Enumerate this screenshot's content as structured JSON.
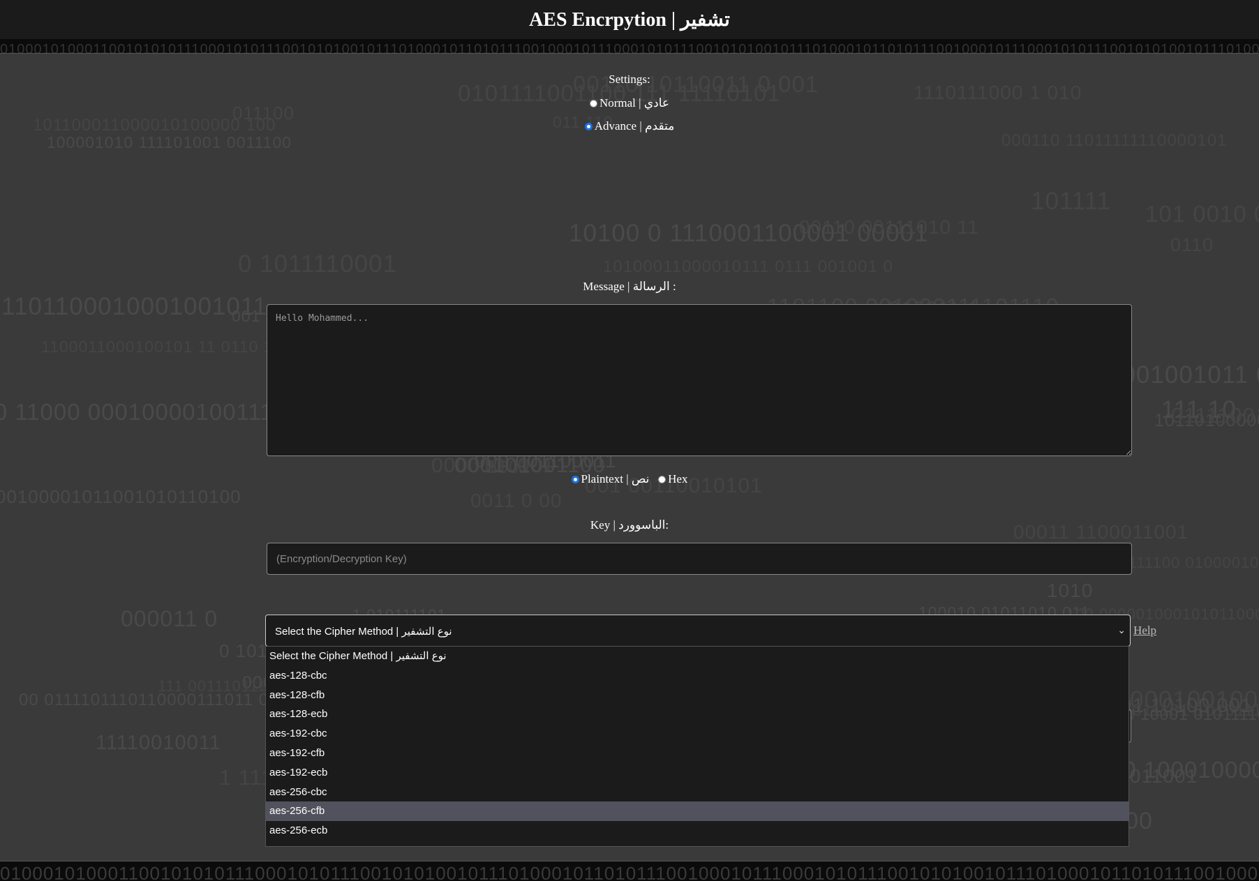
{
  "header": {
    "title": "AES Encrpytion | تشفير"
  },
  "settings": {
    "title": "Settings:",
    "options": [
      {
        "label": "Normal | عادي",
        "checked": false
      },
      {
        "label": "Advance | متقدم",
        "checked": true
      }
    ]
  },
  "message": {
    "label": "Message | الرسالة :",
    "placeholder": "Hello Mohammed...",
    "format_options": [
      {
        "label": "Plaintext | نص",
        "checked": true
      },
      {
        "label": "Hex",
        "checked": false
      }
    ]
  },
  "key": {
    "label": "Key | الباسوورد:",
    "placeholder": "(Encryption/Decryption Key)"
  },
  "cipher": {
    "selected_label": "Select the Cipher Method | نوع التشفير",
    "help_label": "Help",
    "options": [
      "Select the Cipher Method | نوع التشفير",
      "aes-128-cbc",
      "aes-128-cfb",
      "aes-128-ecb",
      "aes-192-cbc",
      "aes-192-cfb",
      "aes-192-ecb",
      "aes-256-cbc",
      "aes-256-cfb",
      "aes-256-ecb"
    ],
    "highlighted_option": "aes-256-cfb"
  },
  "colors": {
    "background": "#3a3a3a",
    "panel": "#1b1b1b",
    "radio_accent": "#1a73e8",
    "highlight": "#52525e"
  }
}
